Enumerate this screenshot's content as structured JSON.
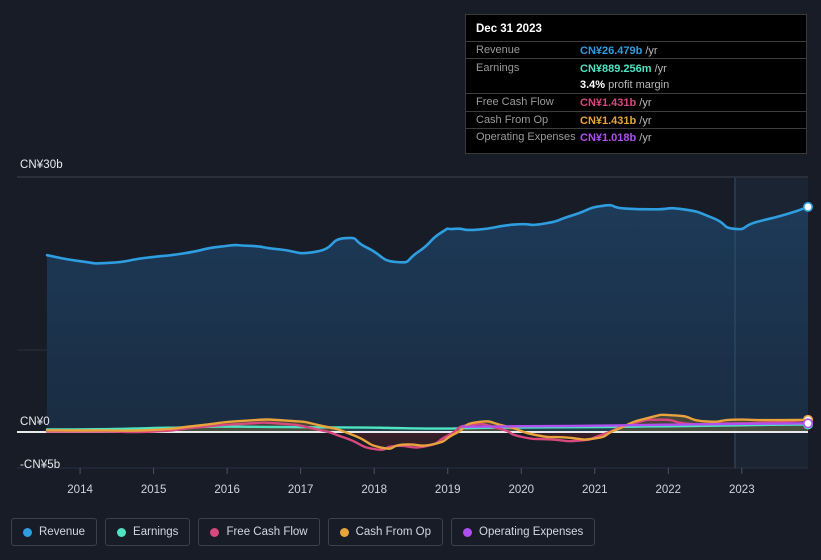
{
  "chart_data": {
    "type": "area",
    "title": "",
    "xlabel": "",
    "ylabel": "",
    "currency": "CN¥",
    "ylim": [
      -5,
      30
    ],
    "grid": true,
    "legend_position": "bottom",
    "y_ticks": [
      {
        "label": "CN¥30b",
        "value": 30
      },
      {
        "label": "CN¥0",
        "value": 0
      },
      {
        "label": "-CN¥5b",
        "value": -5
      }
    ],
    "x_ticks": [
      "2014",
      "2015",
      "2016",
      "2017",
      "2018",
      "2019",
      "2020",
      "2021",
      "2022",
      "2023"
    ],
    "x_range": [
      2013.55,
      2023.9
    ],
    "series": [
      {
        "name": "Revenue",
        "color": "#2e9ee0",
        "x": [
          2013.55,
          2014.0,
          2014.4,
          2014.9,
          2015.4,
          2015.9,
          2016.3,
          2016.7,
          2017.2,
          2017.6,
          2017.9,
          2018.3,
          2018.6,
          2018.9,
          2019.1,
          2019.4,
          2019.9,
          2020.3,
          2020.7,
          2021.1,
          2021.4,
          2021.8,
          2022.2,
          2022.6,
          2022.9,
          2023.2,
          2023.6,
          2023.9
        ],
        "values": [
          20.8,
          20.1,
          19.9,
          20.5,
          21.0,
          21.8,
          21.9,
          21.5,
          21.2,
          22.8,
          21.7,
          20.0,
          21.2,
          23.4,
          23.9,
          23.8,
          24.4,
          24.5,
          25.5,
          26.6,
          26.3,
          26.2,
          26.2,
          25.2,
          23.9,
          24.7,
          25.6,
          26.479
        ]
      },
      {
        "name": "Earnings",
        "color": "#4fe3c1",
        "x": [
          2013.55,
          2014.4,
          2015.2,
          2015.9,
          2016.5,
          2017.2,
          2017.9,
          2018.4,
          2018.9,
          2019.4,
          2019.9,
          2020.5,
          2021.1,
          2021.7,
          2022.3,
          2022.9,
          2023.4,
          2023.9
        ],
        "values": [
          0.3,
          0.35,
          0.5,
          0.62,
          0.6,
          0.55,
          0.52,
          0.45,
          0.4,
          0.48,
          0.52,
          0.55,
          0.58,
          0.65,
          0.7,
          0.78,
          0.84,
          0.889
        ]
      },
      {
        "name": "Free Cash Flow",
        "color": "#d6487e",
        "x": [
          2013.55,
          2014.3,
          2015.0,
          2015.6,
          2016.2,
          2016.7,
          2017.2,
          2017.6,
          2018.0,
          2018.3,
          2018.7,
          2019.0,
          2019.3,
          2019.7,
          2020.0,
          2020.4,
          2020.8,
          2021.1,
          2021.5,
          2021.9,
          2022.3,
          2022.8,
          2023.3,
          2023.9
        ],
        "values": [
          0.05,
          0.05,
          0.05,
          0.55,
          0.95,
          1.0,
          0.35,
          -0.85,
          -2.5,
          -2.05,
          -2.1,
          -0.55,
          0.85,
          0.4,
          -0.7,
          -1.1,
          -1.25,
          -0.4,
          0.95,
          1.45,
          0.95,
          1.0,
          1.1,
          1.431
        ]
      },
      {
        "name": "Cash From Op",
        "color": "#e8a33d",
        "x": [
          2013.55,
          2014.3,
          2015.0,
          2015.6,
          2016.2,
          2016.8,
          2017.3,
          2017.7,
          2018.1,
          2018.4,
          2018.8,
          2019.1,
          2019.4,
          2019.8,
          2020.2,
          2020.6,
          2021.0,
          2021.3,
          2021.7,
          2022.1,
          2022.5,
          2022.9,
          2023.3,
          2023.9
        ],
        "values": [
          0.2,
          0.18,
          0.25,
          0.75,
          1.3,
          1.35,
          0.7,
          -0.4,
          -2.3,
          -1.85,
          -1.8,
          -0.25,
          1.15,
          0.65,
          -0.45,
          -0.8,
          -0.95,
          0.3,
          1.6,
          1.95,
          1.25,
          1.45,
          1.4,
          1.431
        ]
      },
      {
        "name": "Operating Expenses",
        "color": "#b14ef0",
        "x": [
          2019.2,
          2019.8,
          2020.4,
          2021.0,
          2021.6,
          2022.2,
          2022.8,
          2023.3,
          2023.9
        ],
        "values": [
          0.62,
          0.66,
          0.7,
          0.74,
          0.82,
          0.88,
          0.94,
          0.98,
          1.018
        ]
      }
    ]
  },
  "tooltip": {
    "date": "Dec 31 2023",
    "rows": [
      {
        "key": "Revenue",
        "value": "CN¥26.479b",
        "unit": "/yr",
        "color": "#2e9ee0"
      },
      {
        "key": "Earnings",
        "value": "CN¥889.256m",
        "unit": "/yr",
        "color": "#4fe3c1"
      },
      {
        "key": "",
        "value": "3.4%",
        "unit": "profit margin",
        "color": "#ffffff"
      },
      {
        "key": "Free Cash Flow",
        "value": "CN¥1.431b",
        "unit": "/yr",
        "color": "#d6487e"
      },
      {
        "key": "Cash From Op",
        "value": "CN¥1.431b",
        "unit": "/yr",
        "color": "#e8a33d"
      },
      {
        "key": "Operating Expenses",
        "value": "CN¥1.018b",
        "unit": "/yr",
        "color": "#b14ef0"
      }
    ]
  },
  "legend": {
    "items": [
      {
        "label": "Revenue",
        "color": "#2e9ee0"
      },
      {
        "label": "Earnings",
        "color": "#4fe3c1"
      },
      {
        "label": "Free Cash Flow",
        "color": "#d6487e"
      },
      {
        "label": "Cash From Op",
        "color": "#e8a33d"
      },
      {
        "label": "Operating Expenses",
        "color": "#b14ef0"
      }
    ]
  },
  "colors": {
    "background": "#171c27",
    "plot_fill_top": "#1d3a58",
    "plot_fill_bottom": "#1a2c41",
    "negative_fill": "#4d2029",
    "zero_line": "#e8eaee",
    "grid": "#2c3443"
  }
}
